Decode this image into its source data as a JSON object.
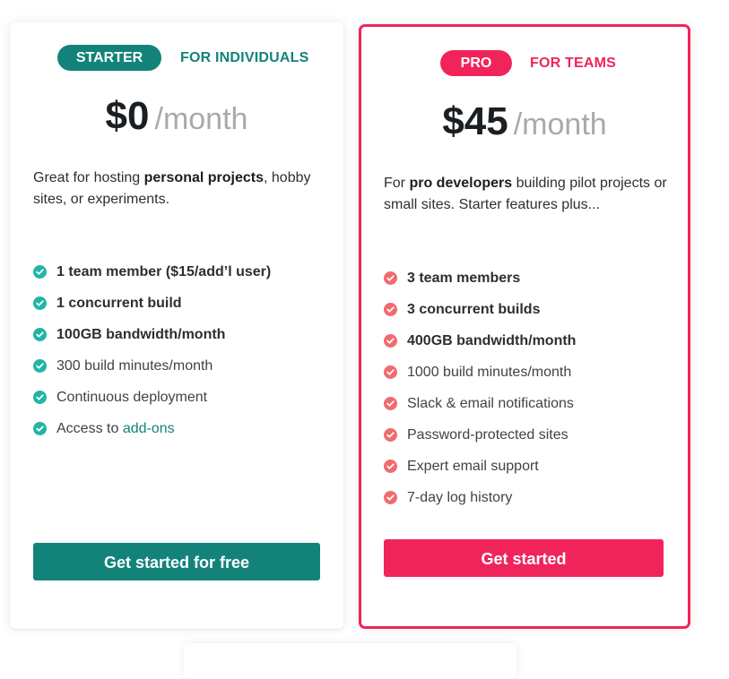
{
  "colors": {
    "starter_accent": "#13837a",
    "starter_check": "#22b5a3",
    "pro_accent": "#f0245b",
    "pro_check": "#f26a6f",
    "muted_period": "#a7aaad"
  },
  "starter": {
    "badge": "STARTER",
    "audience": "FOR INDIVIDUALS",
    "price": "$0",
    "period": "/month",
    "description": {
      "pre": "Great for hosting ",
      "bold": "personal projects",
      "post": ", hobby sites, or experiments."
    },
    "features": [
      {
        "text": "1 team member ($15/add’l user)",
        "bold": true
      },
      {
        "text": "1 concurrent build",
        "bold": true
      },
      {
        "text": "100GB bandwidth/month",
        "bold": true
      },
      {
        "text": "300 build minutes/month",
        "bold": false
      },
      {
        "text": "Continuous deployment",
        "bold": false
      }
    ],
    "addons": {
      "prefix": "Access to ",
      "link": "add-ons"
    },
    "cta": "Get started for free",
    "check_icon": "check-circle-icon"
  },
  "pro": {
    "badge": "PRO",
    "audience": "FOR TEAMS",
    "price": "$45",
    "period": "/month",
    "description": {
      "pre": "For ",
      "bold": "pro developers",
      "post": " building pilot projects or small sites. Starter features plus..."
    },
    "features": [
      {
        "text": "3 team members",
        "bold": true
      },
      {
        "text": "3 concurrent builds",
        "bold": true
      },
      {
        "text": "400GB bandwidth/month",
        "bold": true
      },
      {
        "text": "1000 build minutes/month",
        "bold": false
      },
      {
        "text": "Slack & email notifications",
        "bold": false
      },
      {
        "text": "Password-protected sites",
        "bold": false
      },
      {
        "text": "Expert email support",
        "bold": false
      },
      {
        "text": "7-day log history",
        "bold": false
      }
    ],
    "cta": "Get started",
    "check_icon": "check-circle-icon"
  }
}
